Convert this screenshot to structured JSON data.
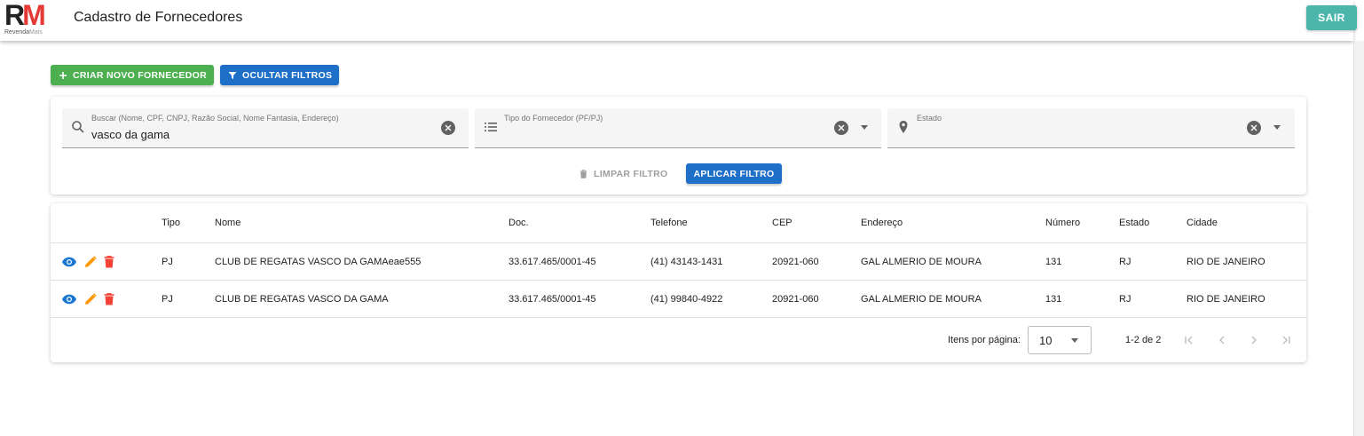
{
  "header": {
    "logo_letters_r": "R",
    "logo_letters_m": "M",
    "logo_sub_main": "Revenda",
    "logo_sub_mais": "Mais",
    "title": "Cadastro de Fornecedores",
    "logout_label": "SAIR"
  },
  "toolbar": {
    "create_label": "CRIAR NOVO FORNECEDOR",
    "hide_filters_label": "OCULTAR FILTROS"
  },
  "filters": {
    "search": {
      "label": "Buscar (Nome, CPF, CNPJ, Razão Social, Nome Fantasia, Endereço)",
      "value": "vasco da gama"
    },
    "tipo": {
      "label": "Tipo do Fornecedor (PF/PJ)",
      "value": ""
    },
    "estado": {
      "label": "Estado",
      "value": ""
    },
    "clear_label": "LIMPAR FILTRO",
    "apply_label": "APLICAR FILTRO"
  },
  "table": {
    "columns": [
      "Tipo",
      "Nome",
      "Doc.",
      "Telefone",
      "CEP",
      "Endereço",
      "Número",
      "Estado",
      "Cidade"
    ],
    "rows": [
      {
        "tipo": "PJ",
        "nome": "CLUB DE REGATAS VASCO DA GAMAeae555",
        "doc": "33.617.465/0001-45",
        "telefone": "(41) 43143-1431",
        "cep": "20921-060",
        "endereco": "GAL ALMERIO DE MOURA",
        "numero": "131",
        "estado": "RJ",
        "cidade": "RIO DE JANEIRO"
      },
      {
        "tipo": "PJ",
        "nome": "CLUB DE REGATAS VASCO DA GAMA",
        "doc": "33.617.465/0001-45",
        "telefone": "(41) 99840-4922",
        "cep": "20921-060",
        "endereco": "GAL ALMERIO DE MOURA",
        "numero": "131",
        "estado": "RJ",
        "cidade": "RIO DE JANEIRO"
      }
    ]
  },
  "pagination": {
    "items_per_page_label": "Itens por página:",
    "items_per_page_value": "10",
    "range_label": "1-2 de 2"
  },
  "colors": {
    "green": "#4caf50",
    "blue": "#1e6fc8",
    "teal": "#4db6ac",
    "view_icon": "#1976d2",
    "edit_icon": "#ff9800",
    "delete_icon": "#f44336"
  },
  "icons": [
    "plus-icon",
    "filter-icon",
    "search-icon",
    "list-icon",
    "location-pin-icon",
    "clear-icon",
    "chevron-down-icon",
    "trash-icon",
    "eye-icon",
    "pencil-icon",
    "first-page-icon",
    "prev-page-icon",
    "next-page-icon",
    "last-page-icon"
  ]
}
